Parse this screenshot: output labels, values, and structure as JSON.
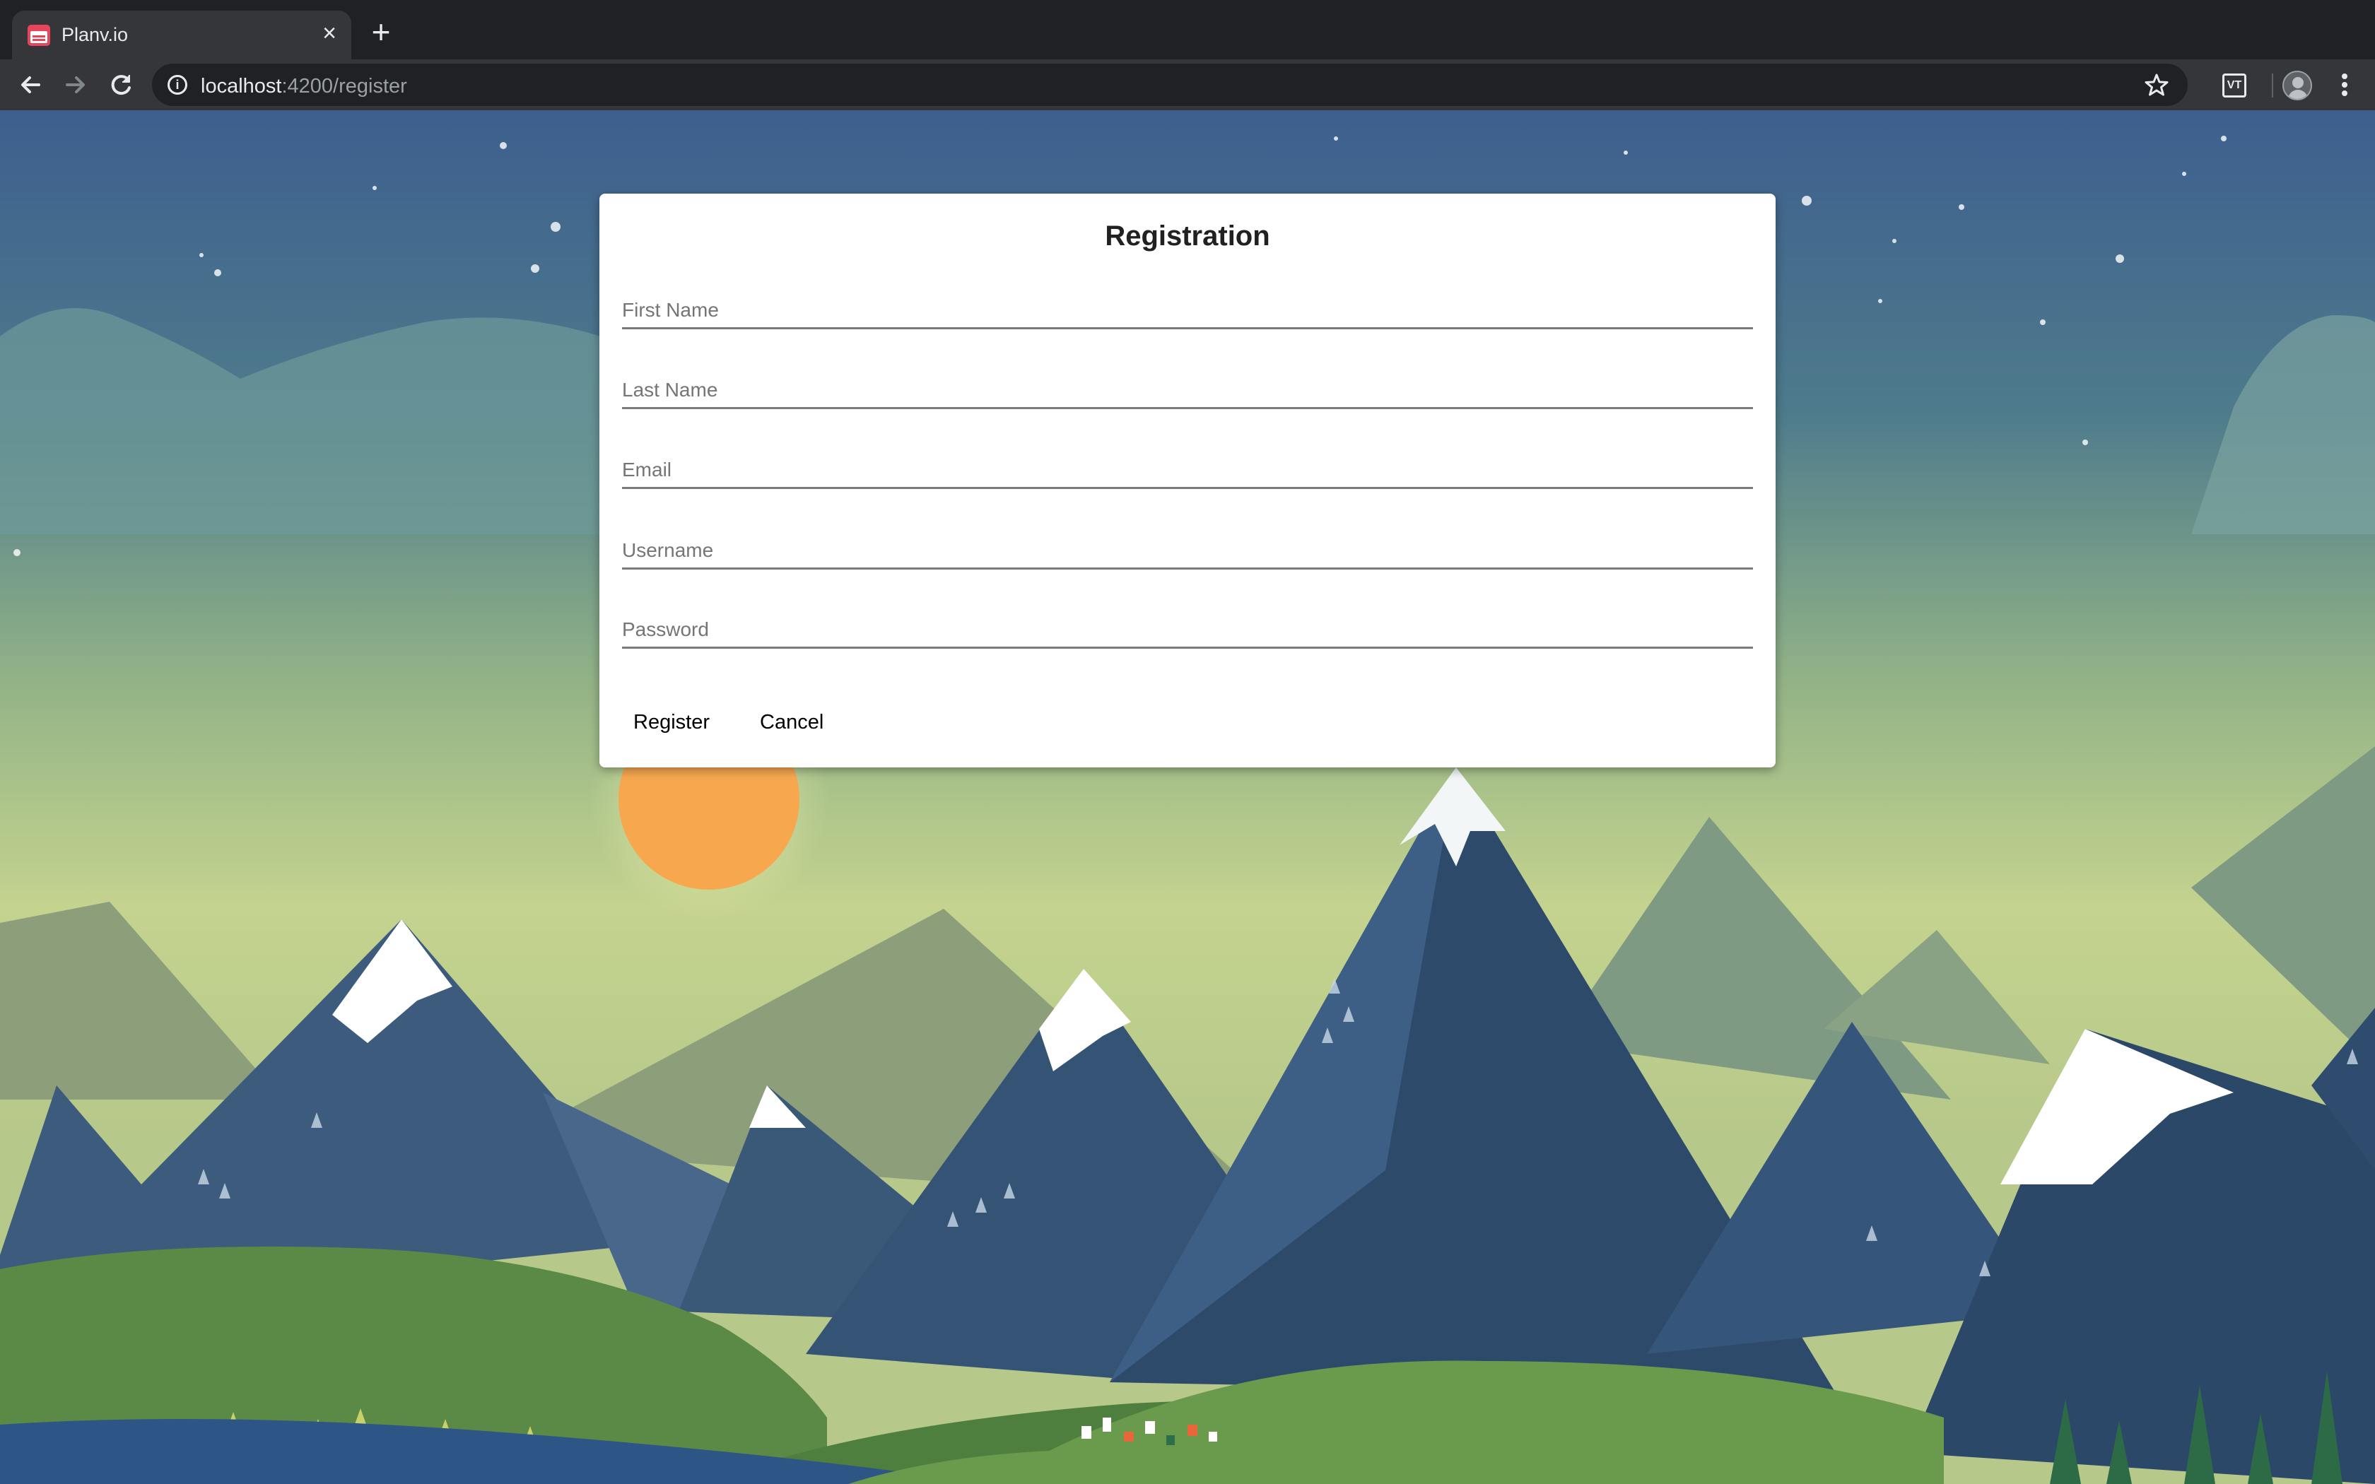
{
  "browser": {
    "tab_title": "Planv.io",
    "url_host": "localhost",
    "url_path": ":4200/register"
  },
  "icons": [
    "favicon-icon",
    "close-icon",
    "plus-icon",
    "back-arrow-icon",
    "forward-arrow-icon",
    "reload-icon",
    "info-icon",
    "star-icon",
    "extension-icon",
    "avatar",
    "kebab-menu-icon"
  ],
  "form": {
    "title": "Registration",
    "fields": [
      {
        "placeholder": "First Name",
        "value": ""
      },
      {
        "placeholder": "Last Name",
        "value": ""
      },
      {
        "placeholder": "Email",
        "value": ""
      },
      {
        "placeholder": "Username",
        "value": ""
      },
      {
        "placeholder": "Password",
        "value": ""
      }
    ],
    "register_label": "Register",
    "cancel_label": "Cancel"
  },
  "colors": {
    "chrome_dark": "#202124",
    "chrome_toolbar": "#35363a",
    "sky_top": "#3d5f8e",
    "sky_horizon": "#c4d38e",
    "sun": "#f7a84f",
    "mountain_dark": "#2d4a6b",
    "grass": "#5a8a45",
    "lake": "#2d5585"
  }
}
